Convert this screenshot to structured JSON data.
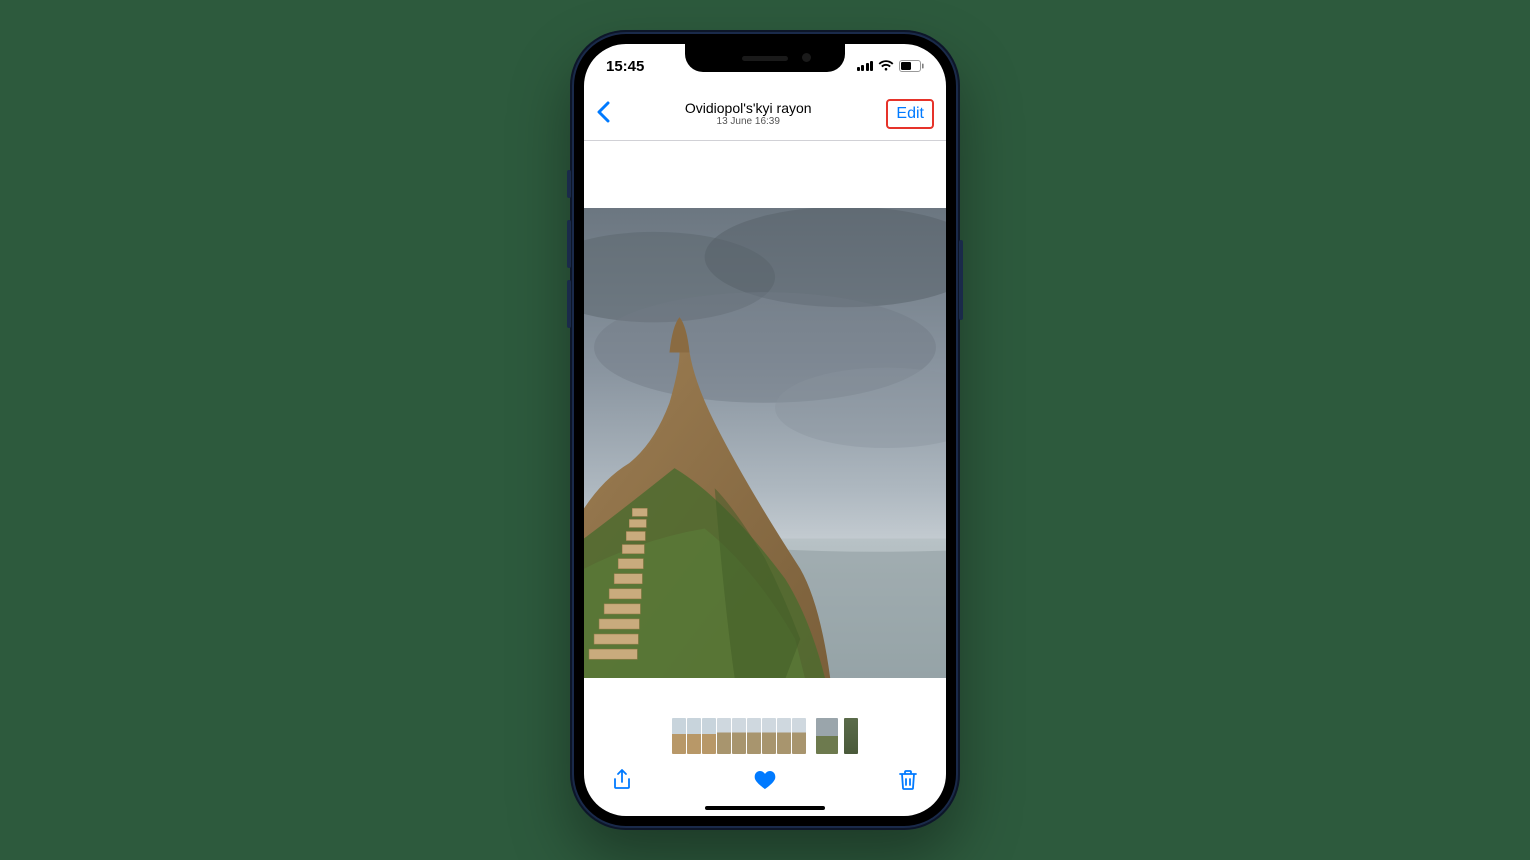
{
  "status": {
    "time": "15:45"
  },
  "nav": {
    "location": "Ovidiopol's'kyi rayon",
    "datetime": "13 June  16:39",
    "edit_label": "Edit"
  },
  "colors": {
    "accent": "#007aff",
    "highlight_border": "#e6332a"
  },
  "thumbnails": [
    {
      "w": 14,
      "bg": "linear-gradient(#c8d4dc 45%,#b89868 45%)"
    },
    {
      "w": 14,
      "bg": "linear-gradient(#c8d4dc 45%,#b89868 45%)"
    },
    {
      "w": 14,
      "bg": "linear-gradient(#c8d4dc 45%,#b89868 45%)"
    },
    {
      "w": 14,
      "bg": "linear-gradient(#cfd8df 40%,#a8956e 40%)"
    },
    {
      "w": 14,
      "bg": "linear-gradient(#cfd8df 40%,#a8956e 40%)"
    },
    {
      "w": 14,
      "bg": "linear-gradient(#cfd8df 40%,#a8956e 40%)"
    },
    {
      "w": 14,
      "bg": "linear-gradient(#cfd8df 40%,#a8956e 40%)"
    },
    {
      "w": 14,
      "bg": "linear-gradient(#cfd8df 40%,#a8956e 40%)"
    },
    {
      "w": 14,
      "bg": "linear-gradient(#cfd8df 40%,#a8956e 40%)"
    },
    {
      "w": 8,
      "bg": "transparent"
    },
    {
      "w": 22,
      "bg": "linear-gradient(#9aa5ab 50%,#6d7a4e 50%)"
    },
    {
      "w": 4,
      "bg": "transparent"
    },
    {
      "w": 14,
      "bg": "linear-gradient(#5a6b4a,#4a5a3a)"
    }
  ]
}
